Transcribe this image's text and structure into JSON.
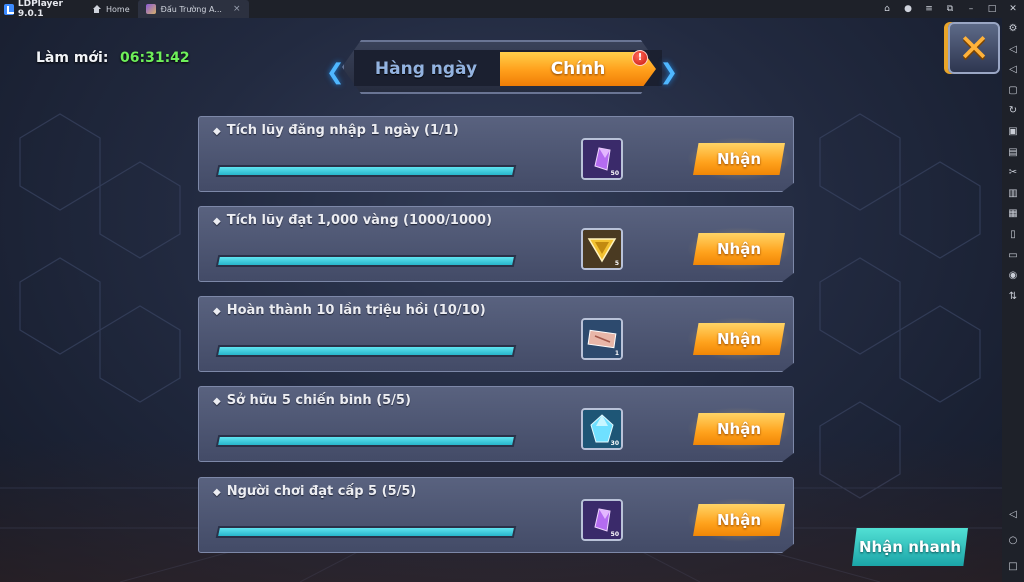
{
  "emulator": {
    "brand": "LDPlayer 9.0.1",
    "tabs": [
      {
        "label": "Home",
        "icon": "home-icon"
      },
      {
        "label": "Đấu Trường A...",
        "icon": "game-icon",
        "close": "×"
      }
    ],
    "window_controls": [
      "gamepad-icon",
      "account-icon",
      "menu-icon",
      "restore-icon",
      "minimize-icon",
      "maximize-icon",
      "close-icon"
    ],
    "sidebar_icons": [
      "settings-icon",
      "volume-up-icon",
      "volume-down-icon",
      "screenshot-icon",
      "rotate-icon",
      "record-icon",
      "keyboard-icon",
      "cut-icon",
      "multi-instance-icon",
      "copy-icon",
      "shake-icon",
      "folder-icon",
      "location-icon",
      "sync-icon"
    ],
    "sidebar_bottom": [
      "back-icon",
      "home-circle-icon",
      "recent-apps-icon"
    ]
  },
  "header": {
    "refresh_label": "Làm mới:",
    "refresh_time": "06:31:42",
    "tabs": [
      {
        "label": "Hàng ngày",
        "active": false
      },
      {
        "label": "Chính",
        "active": true
      }
    ],
    "badge": "!"
  },
  "tasks": [
    {
      "title": "Tích lũy đăng nhập 1 ngày (1/1)",
      "progress": 1.0,
      "reward_icon": "purple-crystal-icon",
      "reward_qty": "50",
      "claim_label": "Nhận"
    },
    {
      "title": "Tích lũy đạt 1,000 vàng (1000/1000)",
      "progress": 1.0,
      "reward_icon": "gold-emblem-icon",
      "reward_qty": "5",
      "claim_label": "Nhận"
    },
    {
      "title": "Hoàn thành 10 lần triệu hồi (10/10)",
      "progress": 1.0,
      "reward_icon": "summon-ticket-icon",
      "reward_qty": "1",
      "claim_label": "Nhận"
    },
    {
      "title": "Sở hữu 5 chiến binh (5/5)",
      "progress": 1.0,
      "reward_icon": "blue-crystal-icon",
      "reward_qty": "30",
      "claim_label": "Nhận"
    },
    {
      "title": "Người chơi đạt cấp 5 (5/5)",
      "progress": 1.0,
      "reward_icon": "purple-crystal-icon",
      "reward_qty": "50",
      "claim_label": "Nhận"
    }
  ],
  "quick_claim_label": "Nhận nhanh",
  "colors": {
    "accent_orange": "#ffa21c",
    "progress_cyan": "#27b6cc",
    "timer_green": "#6ef05a",
    "quick_teal": "#1ba5a8"
  }
}
